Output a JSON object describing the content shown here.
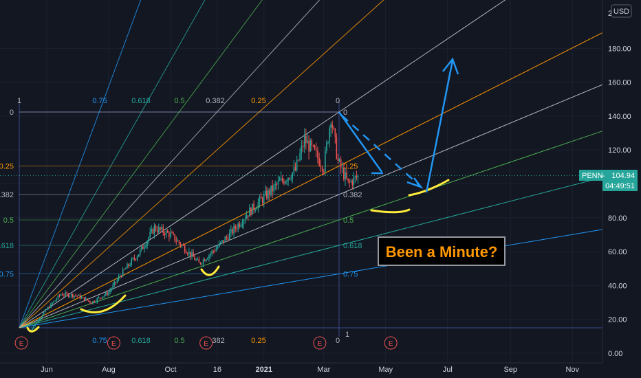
{
  "chart_data": {
    "type": "candlestick",
    "symbol": "PENN",
    "currency": "USD",
    "last_price": "104.94",
    "countdown": "04:49:51",
    "ylim": [
      0,
      200
    ],
    "y_ticks": [
      "0.00",
      "20.00",
      "40.00",
      "60.00",
      "80.00",
      "100.00",
      "120.00",
      "140.00",
      "160.00",
      "180.00"
    ],
    "y_top_partial": "2(",
    "x_ticks": [
      "Jun",
      "Aug",
      "Oct",
      "16",
      "2021",
      "Mar",
      "May",
      "Jul",
      "Sep",
      "Nov"
    ],
    "fib_levels": [
      {
        "label": "0.75",
        "color": "#2196f3"
      },
      {
        "label": "0.618",
        "color": "#26a69a"
      },
      {
        "label": "0.5",
        "color": "#4caf50"
      },
      {
        "label": "0.382",
        "color": "#b2b5be"
      },
      {
        "label": "0.25",
        "color": "#ff9800"
      },
      {
        "label": "0",
        "color": "#b2b5be"
      }
    ],
    "fan_edge_labels": {
      "zero": "0",
      "one": "1"
    },
    "price_path": [
      {
        "date": "2020-05-15",
        "price": 13
      },
      {
        "date": "2020-05-29",
        "price": 24
      },
      {
        "date": "2020-06-15",
        "price": 35
      },
      {
        "date": "2020-07-01",
        "price": 34
      },
      {
        "date": "2020-07-15",
        "price": 30
      },
      {
        "date": "2020-08-01",
        "price": 36
      },
      {
        "date": "2020-08-15",
        "price": 48
      },
      {
        "date": "2020-09-01",
        "price": 60
      },
      {
        "date": "2020-09-15",
        "price": 74
      },
      {
        "date": "2020-10-01",
        "price": 70
      },
      {
        "date": "2020-10-15",
        "price": 62
      },
      {
        "date": "2020-10-29",
        "price": 53
      },
      {
        "date": "2020-11-15",
        "price": 62
      },
      {
        "date": "2020-12-01",
        "price": 72
      },
      {
        "date": "2020-12-15",
        "price": 82
      },
      {
        "date": "2021-01-01",
        "price": 92
      },
      {
        "date": "2021-01-15",
        "price": 100
      },
      {
        "date": "2021-02-01",
        "price": 108
      },
      {
        "date": "2021-02-10",
        "price": 126
      },
      {
        "date": "2021-02-20",
        "price": 118
      },
      {
        "date": "2021-03-01",
        "price": 110
      },
      {
        "date": "2021-03-08",
        "price": 140
      },
      {
        "date": "2021-03-15",
        "price": 113
      },
      {
        "date": "2021-03-25",
        "price": 100
      },
      {
        "date": "2021-04-05",
        "price": 105
      }
    ],
    "annotation": "Been a Minute?",
    "legend": "none",
    "grid": true
  }
}
